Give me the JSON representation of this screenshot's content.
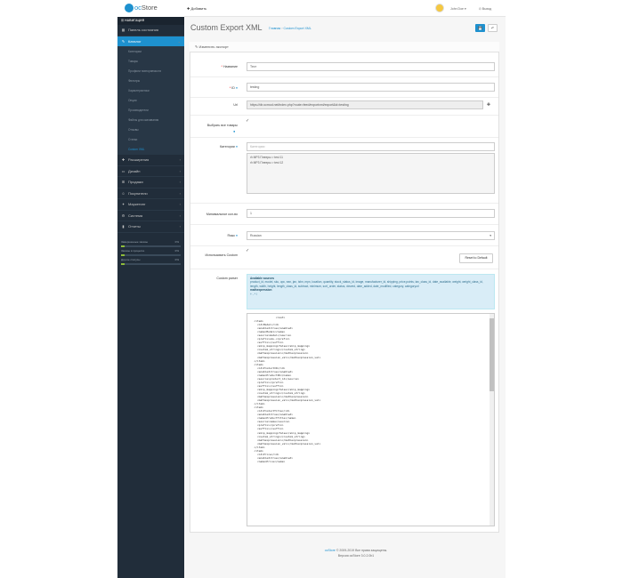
{
  "header": {
    "logo_text": "oc",
    "logo_text2": "Store",
    "add_label": "✚ Добавить",
    "user_name": "John Doe ▾",
    "logout_label": "⏻ Выход"
  },
  "sidebar": {
    "nav_title": "☰ НАВИГАЦИЯ",
    "items": [
      {
        "icon": "▦",
        "label": "Панель состояния"
      },
      {
        "icon": "✎",
        "label": "Каталог",
        "active": true
      }
    ],
    "catalog_sub": [
      "Категории",
      "Товары",
      "Профили повторяемости",
      "Фильтры",
      "Характеристики",
      "Опции",
      "Производители",
      "Файлы для скачивания",
      "Отзывы",
      "Статьи",
      "Custom XML"
    ],
    "items2": [
      {
        "icon": "✚",
        "label": "Расширения"
      },
      {
        "icon": "▭",
        "label": "Дизайн"
      },
      {
        "icon": "⊞",
        "label": "Продажи"
      },
      {
        "icon": "☺",
        "label": "Покупатели"
      },
      {
        "icon": "✦",
        "label": "Маркетинг"
      },
      {
        "icon": "⚙",
        "label": "Система"
      },
      {
        "icon": "▮",
        "label": "Отчеты"
      }
    ],
    "stats": [
      {
        "label": "Завершенные заказы",
        "pct": "0%",
        "value": 0.06
      },
      {
        "label": "Заказы в процессе",
        "pct": "0%",
        "value": 0.06
      },
      {
        "label": "Другие статусы",
        "pct": "0%",
        "value": 0.06
      }
    ]
  },
  "page": {
    "title": "Custom Export XML",
    "crumb_home": "Главная",
    "crumb_sep": "›",
    "crumb_current": "Custom Export XML",
    "save_icon": "💾",
    "back_icon": "↶",
    "panel_title": "✎ Изменить экспорт"
  },
  "form": {
    "name_label": "Название",
    "name_value": "Тест",
    "id_label": "ID",
    "id_value": "testing",
    "url_label": "Url",
    "url_value": "https://dir.ocmod.net/index.php?route=feed/exportxml/export&id=testing",
    "url_btn": "✚",
    "all_products_label": "Выбрать все товары",
    "all_products_check": "✓",
    "categories_label": "Категории",
    "categories_placeholder": "Категории",
    "categories": [
      "⊖ MP3 Плееры > test 11",
      "⊖ MP3 Плееры > test 12"
    ],
    "min_qty_label": "Минимальное кол-во",
    "min_qty_value": "1",
    "lang_label": "Язык",
    "lang_value": "Russian",
    "use_custom_label": "Использовать Custom",
    "use_custom_check": "✓",
    "reset_label": "Reset to Default",
    "custom_label": "Custom parser",
    "sources_title": "Available sources",
    "sources_text": "product_id, model, sku, upc, ean, jan, isbn, mpn, location, quantity, stock_status_id, image, manufacturer_id, shipping, price,points, tax_class_id, date_available, weight, weight_class_id, length, width, height, length_class_id, subtract, minimum, sort_order, status, viewed, date_added, date_modified, category, categoryurl",
    "mathexpr_title": "mathexpression",
    "mathexpr_text": "+ - * /",
    "xml_text": "                <root>\n  <item>\n    <id>Model</id>\n    <enabled>true</enabled>\n    <name>Model</name>\n    <source>model</source>\n    <prefix>sku-</prefix>\n    <suffix></suffix>\n    <skip_mapping>false</skip_mapping>\n    <custom_string></custom_string>\n    <mathexpression></mathexpression>\n    <mathexpression_val></mathexpression_val>\n  </item>\n  <item>\n    <id>ProductID</id>\n    <enabled>true</enabled>\n    <name>ProductID</name>\n    <source>product_id</source>\n    <prefix></prefix>\n    <suffix></suffix>\n    <skip_mapping>false</skip_mapping>\n    <custom_string></custom_string>\n    <mathexpression></mathexpression>\n    <mathexpression_val></mathexpression_val>\n  </item>\n  <item>\n    <id>ProductTitle</id>\n    <enabled>true</enabled>\n    <name>ProductTitle</name>\n    <source>name</source>\n    <prefix></prefix>\n    <suffix></suffix>\n    <skip_mapping>false</skip_mapping>\n    <custom_string></custom_string>\n    <mathexpression></mathexpression>\n    <mathexpression_val></mathexpression_val>\n  </item>\n  <item>\n    <id>Price</id>\n    <enabled>true</enabled>\n    <name>Price</name>"
  },
  "footer": {
    "brand": "ocStore",
    "copyright": " © 2009-2019 Все права защищены.",
    "version": "Версия ocStore 3.0.2.0b1"
  }
}
